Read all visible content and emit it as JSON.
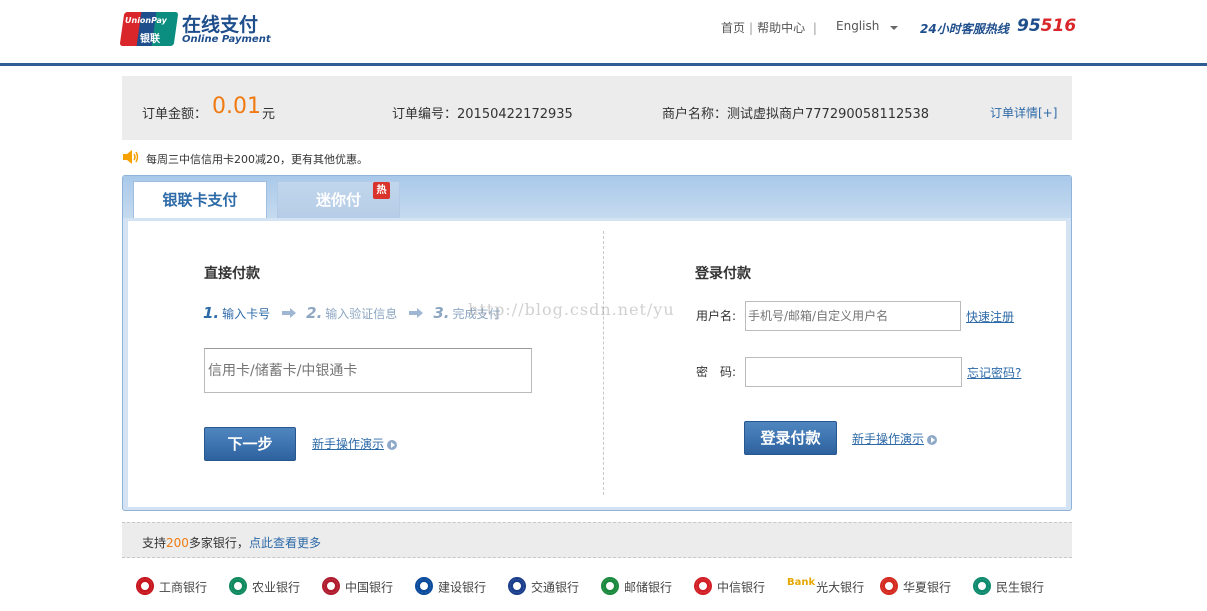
{
  "header": {
    "logo_brand": "UnionPay",
    "logo_brand_cn": "银联",
    "logo_title": "在线支付",
    "logo_subtitle": "Online Payment",
    "nav": [
      "首页",
      "帮助中心"
    ],
    "language": "English",
    "hotline_label": "24小时客服热线",
    "hotline_number": "95516"
  },
  "order": {
    "amount_label": "订单金额：",
    "amount_value": "0.01",
    "amount_unit": "元",
    "order_no": "订单编号：20150422172935",
    "merchant": "商户名称：测试虚拟商户777290058112538",
    "detail_link": "订单详情[+]"
  },
  "promo": {
    "text": "每周三中信信用卡200减20，更有其他优惠。",
    "icon": "speaker-icon"
  },
  "tabs": [
    {
      "label": "银联卡支付",
      "active": true
    },
    {
      "label": "迷你付",
      "active": false,
      "badge": "热"
    }
  ],
  "direct_pay": {
    "title": "直接付款",
    "steps": [
      {
        "num": "1.",
        "label": "输入卡号"
      },
      {
        "num": "2.",
        "label": "输入验证信息"
      },
      {
        "num": "3.",
        "label": "完成支付"
      }
    ],
    "card_placeholder": "信用卡/储蓄卡/中银通卡",
    "next_button": "下一步",
    "demo_link": "新手操作演示"
  },
  "login_pay": {
    "title": "登录付款",
    "username_label": "用户名:",
    "username_placeholder": "手机号/邮箱/自定义用户名",
    "register_link": "快速注册",
    "password_label": "密　码:",
    "forgot_link": "忘记密码?",
    "login_button": "登录付款",
    "demo_link": "新手操作演示"
  },
  "watermark": "http://blog.csdn.net/yu",
  "banks_bar": {
    "prefix": "支持",
    "count": "200",
    "suffix": "多家银行，",
    "more_link": "点此查看更多"
  },
  "banks": [
    {
      "name": "工商银行",
      "color": "#c7161e",
      "icon": "icbc-icon"
    },
    {
      "name": "农业银行",
      "color": "#0f8a5f",
      "icon": "abc-icon"
    },
    {
      "name": "中国银行",
      "color": "#b01c2e",
      "icon": "boc-icon"
    },
    {
      "name": "建设银行",
      "color": "#0a4c9b",
      "icon": "ccb-icon"
    },
    {
      "name": "交通银行",
      "color": "#1a3e8c",
      "icon": "bocom-icon"
    },
    {
      "name": "邮储银行",
      "color": "#1b8a3e",
      "icon": "psbc-icon"
    },
    {
      "name": "中信银行",
      "color": "#d21f26",
      "icon": "citic-icon"
    },
    {
      "name": "光大银行",
      "color": "#e6a800",
      "icon": "ceb-icon",
      "prefix": "Bank"
    },
    {
      "name": "华夏银行",
      "color": "#d42a20",
      "icon": "hxb-icon"
    },
    {
      "name": "民生银行",
      "color": "#0e8a6e",
      "icon": "cmbc-icon"
    }
  ]
}
